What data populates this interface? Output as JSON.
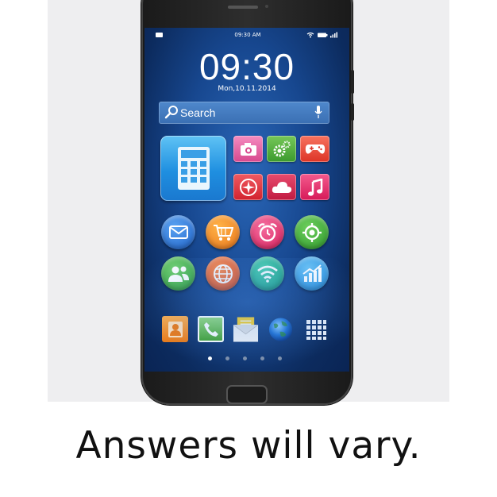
{
  "status_bar": {
    "time": "09:30 AM",
    "icons": [
      "mail-icon",
      "wifi-icon",
      "battery-icon",
      "signal-icon"
    ]
  },
  "lock_screen": {
    "clock": "09:30",
    "date": "Mon,10.11.2014"
  },
  "search": {
    "label": "Search",
    "icons": [
      "magnifier-icon",
      "microphone-icon"
    ]
  },
  "apps": {
    "featured": "calculator-icon",
    "small_tiles": [
      "camera-icon",
      "settings-gears-icon",
      "gamepad-icon",
      "compass-icon",
      "cloud-icon",
      "music-icon"
    ],
    "round_row_1": [
      "mail-icon",
      "shopping-cart-icon",
      "alarm-clock-icon",
      "target-icon"
    ],
    "round_row_2": [
      "contacts-icon",
      "globe-icon",
      "wifi-icon",
      "chart-icon"
    ],
    "dock": [
      "contacts-book-icon",
      "phone-icon",
      "message-icon",
      "earth-icon",
      "app-grid-icon"
    ]
  },
  "pagination": {
    "pages": 5,
    "current": 1
  },
  "caption": "Answers will vary.",
  "colors": {
    "screen_top": "#17478f",
    "camera": "#e45a9c",
    "settings": "#4aa83a",
    "gamepad": "#ea4a3c",
    "compass": "#e4343f",
    "cloud": "#d4244c",
    "music": "#e62a6a",
    "mail": "#2a6fd0",
    "cart": "#f08a20",
    "alarm": "#e2286c",
    "target": "#3fae3a",
    "contacts": "#3fb340",
    "globe": "#f06a24",
    "wifi": "#23b190",
    "chart": "#2f9fe2"
  }
}
